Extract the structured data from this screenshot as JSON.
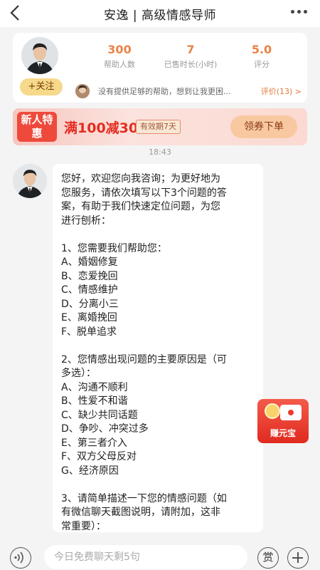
{
  "header": {
    "title": "安逸 | 高级情感导师",
    "back_icon": "chevron-left-icon",
    "more_icon": "more-dots-icon"
  },
  "profile": {
    "follow_label": "+关注",
    "stats": [
      {
        "value": "300",
        "label": "帮助人数"
      },
      {
        "value": "7",
        "label": "已售时长(小时)"
      },
      {
        "value": "5.0",
        "label": "评分"
      }
    ],
    "review_text": "没有提供足够的帮助，想到让我更困...",
    "review_link": "评价(13) >"
  },
  "coupon": {
    "tag": "新人特惠",
    "main": "满100减30",
    "valid": "有效期7天",
    "button": "领券下单"
  },
  "timestamp": "18:43",
  "message": {
    "lines": [
      "您好，欢迎您向我咨询；为更好地为",
      "您服务，请依次填写以下3个问题的答",
      "案，有助于我们快速定位问题，为您",
      "进行刨析：",
      "",
      "1、您需要我们帮助您：",
      "A、婚姻修复",
      "B、恋爱挽回",
      "C、情感维护",
      "D、分离小三",
      "E、离婚挽回",
      "F、脱单追求",
      "",
      "2、您情感出现问题的主要原因是（可",
      "多选）：",
      "A、沟通不顺利",
      "B、性爱不和谐",
      "C、缺少共同话题",
      "D、争吵、冲突过多",
      "E、第三者介入",
      "F、双方父母反对",
      "G、经济原因",
      "",
      "3、请简单描述一下您的情感问题（如",
      "有微信聊天截图说明，请附加，这非",
      "常重要）："
    ]
  },
  "float_widget": {
    "label": "赚元宝"
  },
  "input": {
    "placeholder": "今日免费聊天剩5句",
    "reward_label": "赏"
  },
  "colors": {
    "accent": "#e9844a",
    "coupon_red": "#ee4a3c",
    "follow_yellow": "#f6d98b"
  }
}
